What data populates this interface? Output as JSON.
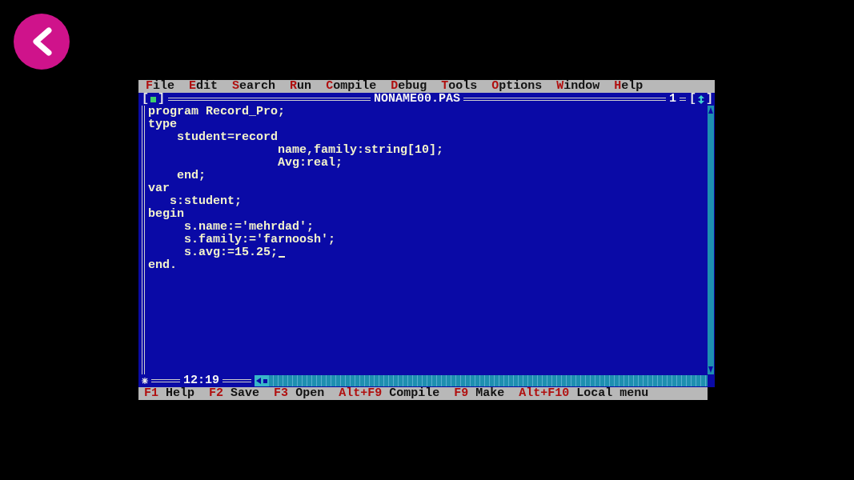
{
  "menu": [
    {
      "label": "File"
    },
    {
      "label": "Edit"
    },
    {
      "label": "Search"
    },
    {
      "label": "Run"
    },
    {
      "label": "Compile"
    },
    {
      "label": "Debug"
    },
    {
      "label": "Tools"
    },
    {
      "label": "Options"
    },
    {
      "label": "Window"
    },
    {
      "label": "Help"
    }
  ],
  "editor": {
    "close_button": {
      "open": "[",
      "close": "]"
    },
    "title": "NONAME00.PAS",
    "zoom_button": {
      "open": "[",
      "close": "]"
    },
    "window_number": "1",
    "position": "12:19",
    "lines": [
      {
        "text": "program Record_Pro;",
        "cursor": false
      },
      {
        "text": "type",
        "cursor": false
      },
      {
        "text": "    student=record",
        "cursor": false
      },
      {
        "text": "                  name,family:string[10];",
        "cursor": false
      },
      {
        "text": "                  Avg:real;",
        "cursor": false
      },
      {
        "text": "    end;",
        "cursor": false
      },
      {
        "text": "var",
        "cursor": false
      },
      {
        "text": "   s:student;",
        "cursor": false
      },
      {
        "text": "begin",
        "cursor": false
      },
      {
        "text": "     s.name:='mehrdad';",
        "cursor": false
      },
      {
        "text": "     s.family:='farnoosh';",
        "cursor": false
      },
      {
        "text": "     s.avg:=15.25;",
        "cursor": true
      },
      {
        "text": "end.",
        "cursor": false
      }
    ]
  },
  "status_bar": [
    {
      "key": "F1",
      "action": "Help"
    },
    {
      "key": "F2",
      "action": "Save"
    },
    {
      "key": "F3",
      "action": "Open"
    },
    {
      "key": "Alt+F9",
      "action": "Compile"
    },
    {
      "key": "F9",
      "action": "Make"
    },
    {
      "key": "Alt+F10",
      "action": "Local menu"
    }
  ]
}
